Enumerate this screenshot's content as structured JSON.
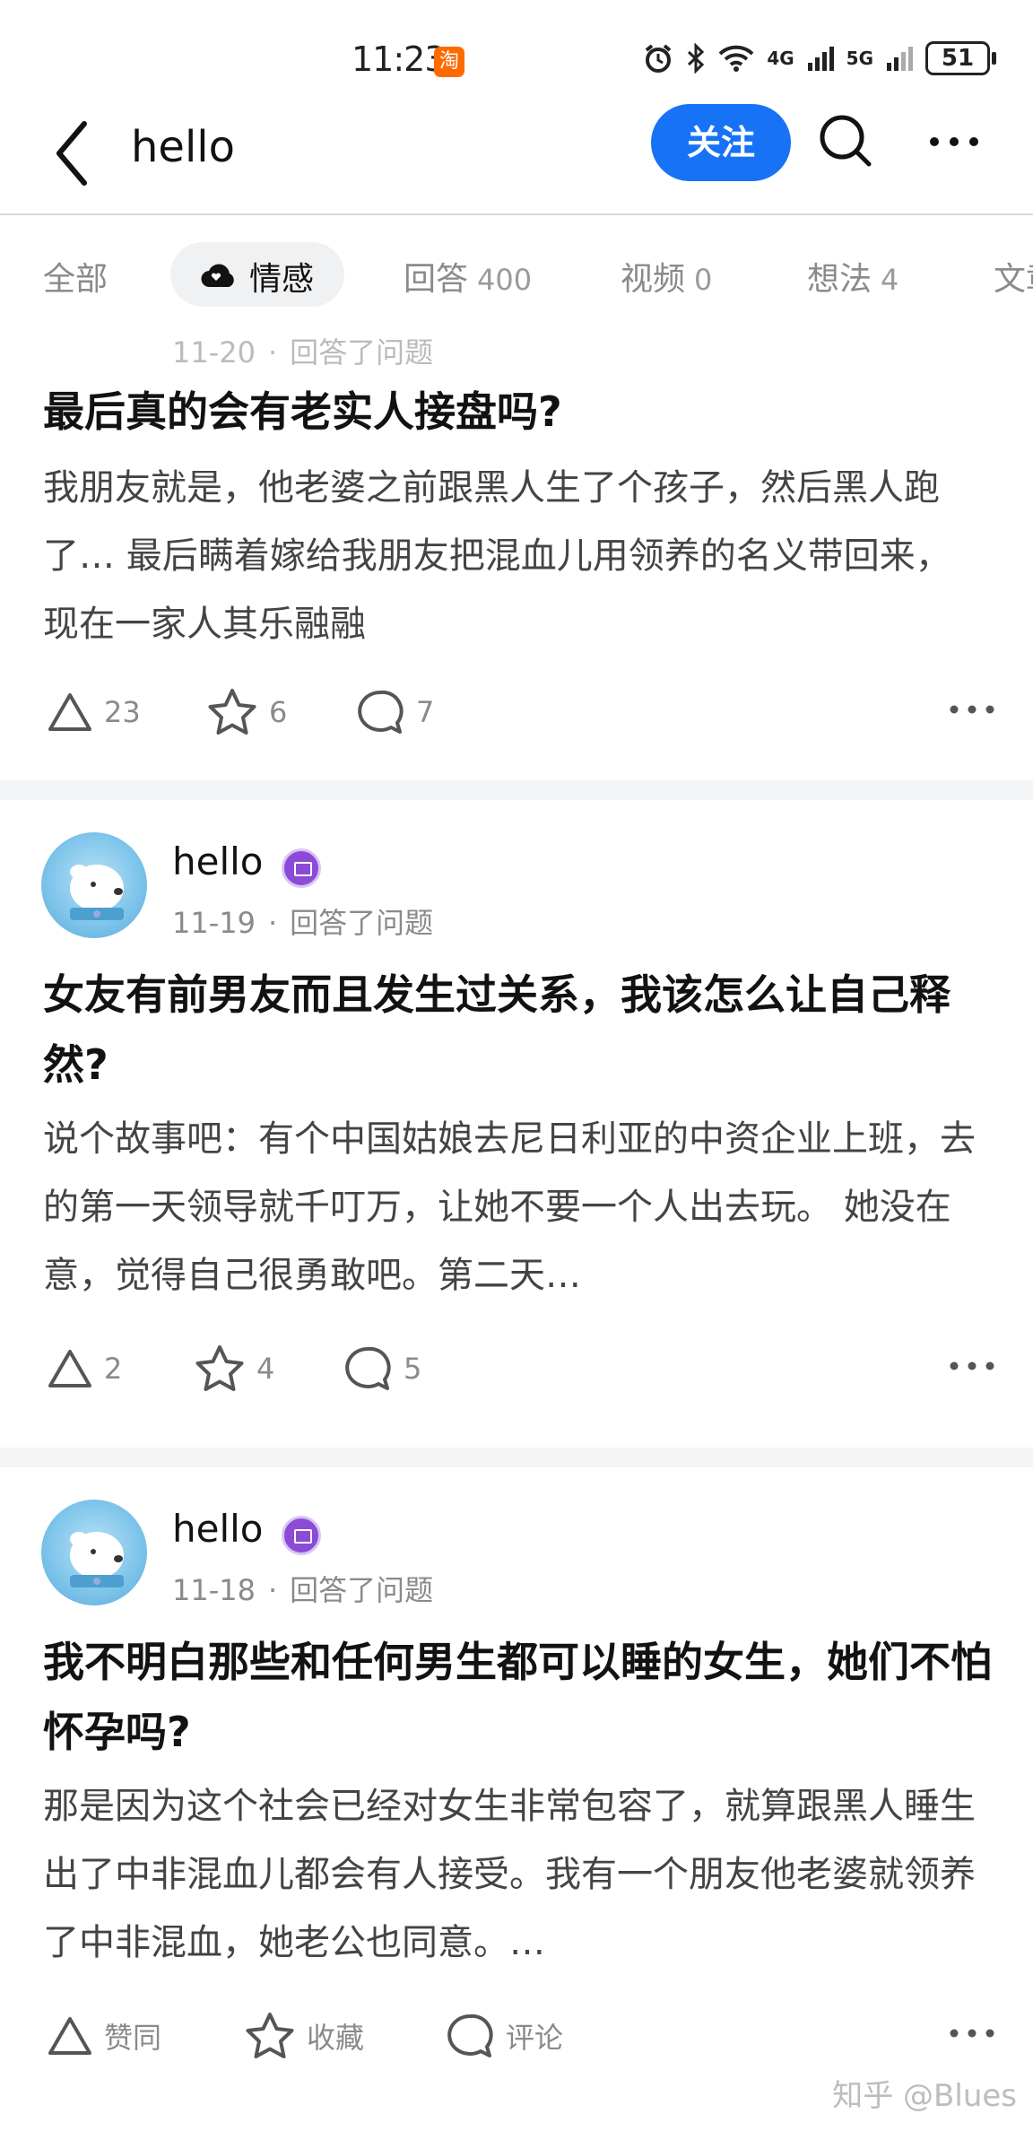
{
  "status_bar": {
    "time": "11:23",
    "taobao_badge": "淘",
    "network": [
      "4G",
      "5G"
    ],
    "battery": "51"
  },
  "header": {
    "title": "hello",
    "follow_label": "关注"
  },
  "tabs": [
    {
      "label": "全部",
      "count": ""
    },
    {
      "label": "情感",
      "count": "",
      "active": true
    },
    {
      "label": "回答",
      "count": "400"
    },
    {
      "label": "视频",
      "count": "0"
    },
    {
      "label": "想法",
      "count": "4"
    },
    {
      "label": "文章",
      "count": ""
    }
  ],
  "feed": [
    {
      "author": "",
      "date": "11-20",
      "action": "回答了问题",
      "title": "最后真的会有老实人接盘吗?",
      "excerpt": "我朋友就是，他老婆之前跟黑人生了个孩子，然后黑人跑了… 最后瞒着嫁给我朋友把混血儿用领养的名义带回来，现在一家人其乐融融",
      "upvotes": "23",
      "favorites": "6",
      "comments": "7"
    },
    {
      "author": "hello",
      "date": "11-19",
      "action": "回答了问题",
      "title": "女友有前男友而且发生过关系，我该怎么让自己释然?",
      "excerpt": "说个故事吧：有个中国姑娘去尼日利亚的中资企业上班，去的第一天领导就千叮万，让她不要一个人出去玩。 她没在意，觉得自己很勇敢吧。第二天…",
      "upvotes": "2",
      "favorites": "4",
      "comments": "5"
    },
    {
      "author": "hello",
      "date": "11-18",
      "action": "回答了问题",
      "title": "我不明白那些和任何男生都可以睡的女生，她们不怕怀孕吗?",
      "excerpt": "那是因为这个社会已经对女生非常包容了，就算跟黑人睡生出了中非混血儿都会有人接受。我有一个朋友他老婆就领养了中非混血，她老公也同意。…",
      "upvotes": "赞同",
      "favorites": "收藏",
      "comments": "评论"
    }
  ],
  "watermark": "知乎 @Blues",
  "colors": {
    "accent": "#1772f6",
    "badge": "#8c4bd6",
    "taobao": "#ff6a00"
  }
}
